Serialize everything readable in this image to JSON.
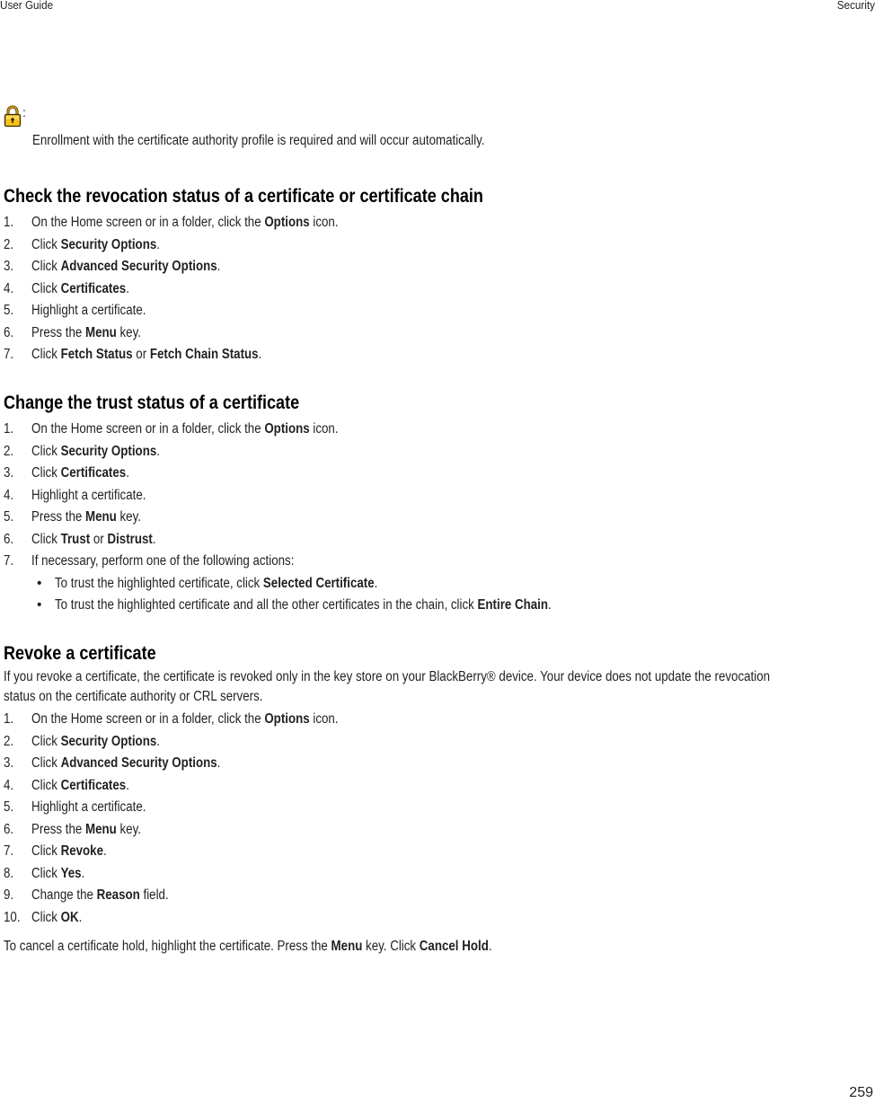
{
  "header": {
    "left": "User Guide",
    "right": "Security"
  },
  "note": {
    "icon": "lock-icon",
    "icon_color": "#f5b800",
    "colon": ":",
    "text": "Enrollment with the certificate authority profile is required and will occur automatically."
  },
  "sections": [
    {
      "title": "Check the revocation status of a certificate or certificate chain",
      "steps": [
        {
          "num": "1.",
          "parts": [
            {
              "t": "On the Home screen or in a folder, click the "
            },
            {
              "t": "Options",
              "b": true
            },
            {
              "t": " icon."
            }
          ]
        },
        {
          "num": "2.",
          "parts": [
            {
              "t": "Click "
            },
            {
              "t": "Security Options",
              "b": true
            },
            {
              "t": "."
            }
          ]
        },
        {
          "num": "3.",
          "parts": [
            {
              "t": "Click "
            },
            {
              "t": "Advanced Security Options",
              "b": true
            },
            {
              "t": "."
            }
          ]
        },
        {
          "num": "4.",
          "parts": [
            {
              "t": "Click "
            },
            {
              "t": "Certificates",
              "b": true
            },
            {
              "t": "."
            }
          ]
        },
        {
          "num": "5.",
          "parts": [
            {
              "t": "Highlight a certificate."
            }
          ]
        },
        {
          "num": "6.",
          "parts": [
            {
              "t": "Press the "
            },
            {
              "t": "Menu",
              "b": true
            },
            {
              "t": " key."
            }
          ]
        },
        {
          "num": "7.",
          "parts": [
            {
              "t": "Click "
            },
            {
              "t": "Fetch Status",
              "b": true
            },
            {
              "t": " or "
            },
            {
              "t": "Fetch Chain Status",
              "b": true
            },
            {
              "t": "."
            }
          ]
        }
      ]
    },
    {
      "title": "Change the trust status of a certificate",
      "steps": [
        {
          "num": "1.",
          "parts": [
            {
              "t": "On the Home screen or in a folder, click the "
            },
            {
              "t": "Options",
              "b": true
            },
            {
              "t": " icon."
            }
          ]
        },
        {
          "num": "2.",
          "parts": [
            {
              "t": "Click "
            },
            {
              "t": "Security Options",
              "b": true
            },
            {
              "t": "."
            }
          ]
        },
        {
          "num": "3.",
          "parts": [
            {
              "t": "Click "
            },
            {
              "t": "Certificates",
              "b": true
            },
            {
              "t": "."
            }
          ]
        },
        {
          "num": "4.",
          "parts": [
            {
              "t": "Highlight a certificate."
            }
          ]
        },
        {
          "num": "5.",
          "parts": [
            {
              "t": "Press the "
            },
            {
              "t": "Menu",
              "b": true
            },
            {
              "t": " key."
            }
          ]
        },
        {
          "num": "6.",
          "parts": [
            {
              "t": "Click "
            },
            {
              "t": "Trust",
              "b": true
            },
            {
              "t": " or "
            },
            {
              "t": "Distrust",
              "b": true
            },
            {
              "t": "."
            }
          ]
        },
        {
          "num": "7.",
          "parts": [
            {
              "t": "If necessary, perform one of the following actions:"
            }
          ]
        },
        {
          "bullet": "•",
          "parts": [
            {
              "t": "To trust the highlighted certificate, click "
            },
            {
              "t": "Selected Certificate",
              "b": true
            },
            {
              "t": "."
            }
          ]
        },
        {
          "bullet": "•",
          "parts": [
            {
              "t": "To trust the highlighted certificate and all the other certificates in the chain, click "
            },
            {
              "t": "Entire Chain",
              "b": true
            },
            {
              "t": "."
            }
          ]
        }
      ]
    },
    {
      "title": "Revoke a certificate",
      "intro": [
        "If you revoke a certificate, the certificate is revoked only in the key store on your BlackBerry® device. Your device does not update the revocation",
        "status on the certificate authority or CRL servers."
      ],
      "steps": [
        {
          "num": "1.",
          "parts": [
            {
              "t": "On the Home screen or in a folder, click the "
            },
            {
              "t": "Options",
              "b": true
            },
            {
              "t": " icon."
            }
          ]
        },
        {
          "num": "2.",
          "parts": [
            {
              "t": "Click "
            },
            {
              "t": "Security Options",
              "b": true
            },
            {
              "t": "."
            }
          ]
        },
        {
          "num": "3.",
          "parts": [
            {
              "t": "Click "
            },
            {
              "t": "Advanced Security Options",
              "b": true
            },
            {
              "t": "."
            }
          ]
        },
        {
          "num": "4.",
          "parts": [
            {
              "t": "Click "
            },
            {
              "t": "Certificates",
              "b": true
            },
            {
              "t": "."
            }
          ]
        },
        {
          "num": "5.",
          "parts": [
            {
              "t": "Highlight a certificate."
            }
          ]
        },
        {
          "num": "6.",
          "parts": [
            {
              "t": "Press the "
            },
            {
              "t": "Menu",
              "b": true
            },
            {
              "t": " key."
            }
          ]
        },
        {
          "num": "7.",
          "parts": [
            {
              "t": "Click "
            },
            {
              "t": "Revoke",
              "b": true
            },
            {
              "t": "."
            }
          ]
        },
        {
          "num": "8.",
          "parts": [
            {
              "t": "Click "
            },
            {
              "t": "Yes",
              "b": true
            },
            {
              "t": "."
            }
          ]
        },
        {
          "num": "9.",
          "parts": [
            {
              "t": "Change the "
            },
            {
              "t": "Reason",
              "b": true
            },
            {
              "t": " field."
            }
          ]
        },
        {
          "num": "10.",
          "parts": [
            {
              "t": "Click "
            },
            {
              "t": "OK",
              "b": true
            },
            {
              "t": "."
            }
          ]
        }
      ],
      "outro": [
        {
          "t": "To cancel a certificate hold, highlight the certificate. Press the "
        },
        {
          "t": "Menu",
          "b": true
        },
        {
          "t": " key. Click "
        },
        {
          "t": "Cancel Hold",
          "b": true
        },
        {
          "t": "."
        }
      ]
    }
  ],
  "footer": {
    "page_number": "259"
  }
}
